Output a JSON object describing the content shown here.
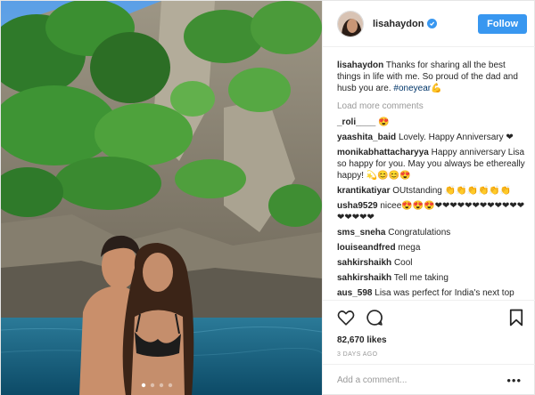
{
  "post": {
    "photo": "couple-at-sea-cliff-photo",
    "carousel_dot_count": 4,
    "carousel_active_dot": 0
  },
  "header": {
    "username": "lisahaydon",
    "verified_icon": "verified-badge-icon",
    "follow_label": "Follow"
  },
  "caption": {
    "username": "lisahaydon",
    "text": "Thanks for sharing all the best things in life with me. So proud of the dad and husb you are.",
    "hashtag": "#oneyear💪"
  },
  "load_more_label": "Load more comments",
  "comments": [
    {
      "user": "_roli____",
      "text": "😍"
    },
    {
      "user": "yaashita_baid",
      "text": "Lovely. Happy Anniversary ❤"
    },
    {
      "user": "monikabhattacharyya",
      "text": "Happy anniversary Lisa so happy for you. May you always be ethereally happy! 💫😊😊😍"
    },
    {
      "user": "krantikatiyar",
      "text": "OUtstanding 👏👏👏👏👏👏"
    },
    {
      "user": "usha9529",
      "text": "nicee😍😍😍❤❤❤❤❤❤❤❤❤❤❤❤❤❤❤❤❤"
    },
    {
      "user": "sms_sneha",
      "text": "Congratulations"
    },
    {
      "user": "louiseandfred",
      "text": "mega"
    },
    {
      "user": "sahkirshaikh",
      "text": "Cool"
    },
    {
      "user": "sahkirshaikh",
      "text": "Tell me taking"
    },
    {
      "user": "aus_598",
      "text": "Lisa was perfect for India's next top"
    }
  ],
  "actions": {
    "like_icon": "heart-outline-icon",
    "comment_icon": "comment-bubble-icon",
    "save_icon": "bookmark-icon"
  },
  "likes": "82,670 likes",
  "timestamp": "3 DAYS AGO",
  "add_comment": {
    "placeholder": "Add a comment...",
    "more_icon": "more-options-icon"
  },
  "colors": {
    "accent": "#3897f0",
    "text": "#262626",
    "muted": "#999999",
    "hashtag": "#003569",
    "border": "#efefef"
  }
}
